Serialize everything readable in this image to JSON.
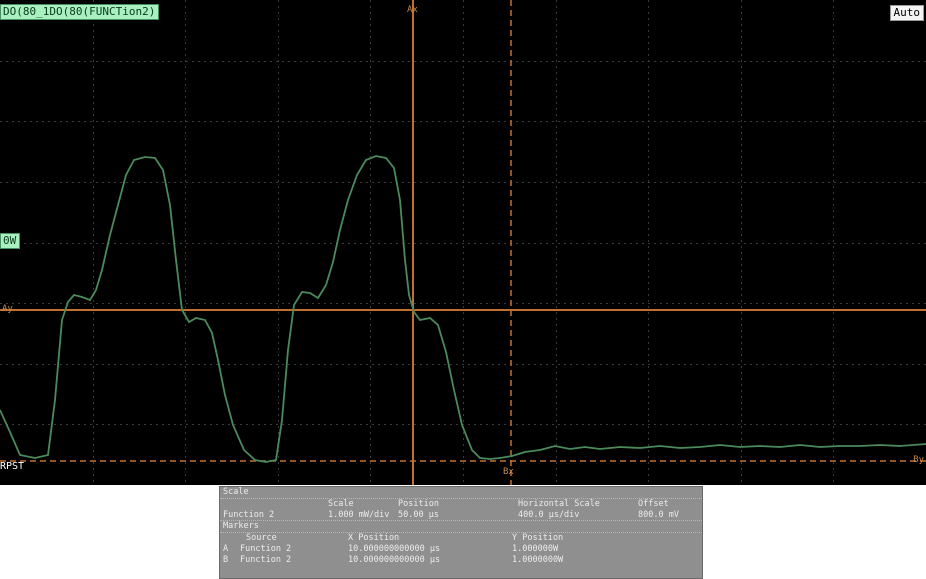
{
  "scope": {
    "function_label": "DO(80_1DO(80(FUNCTion2)",
    "run_status": "Auto",
    "scale_label": "0W",
    "rpst_label": "RPST",
    "marker_ax": "Ax",
    "marker_ay": "Ay",
    "marker_bx": "Bx",
    "marker_by": "By",
    "colors": {
      "background": "#000000",
      "grid": "#3a3a3a",
      "trace": "#4a8a5c",
      "cursor": "#c2702f",
      "label_bg": "#a8f0c0"
    }
  },
  "measurements": {
    "header_title": "Scale",
    "col_headers": {
      "scale": "Scale",
      "position": "Position",
      "horizontal_scale": "Horizontal Scale",
      "offset": "Offset"
    },
    "function_row": {
      "name": "Function 2",
      "scale": "1.000 mW/div",
      "position": "50.00 µs",
      "horizontal_scale": "400.0 µs/div",
      "offset": "800.0 mV"
    },
    "markers_title": "Markers",
    "marker_headers": {
      "source": "Source",
      "x_position": "X Position",
      "y_position": "Y Position"
    },
    "markers": [
      {
        "id": "A",
        "source": "Function 2",
        "x": "10.000000000000 µs",
        "y": "1.000000W"
      },
      {
        "id": "B",
        "source": "Function 2",
        "x": "10.000000000000 µs",
        "y": "1.0000000W"
      }
    ]
  }
}
